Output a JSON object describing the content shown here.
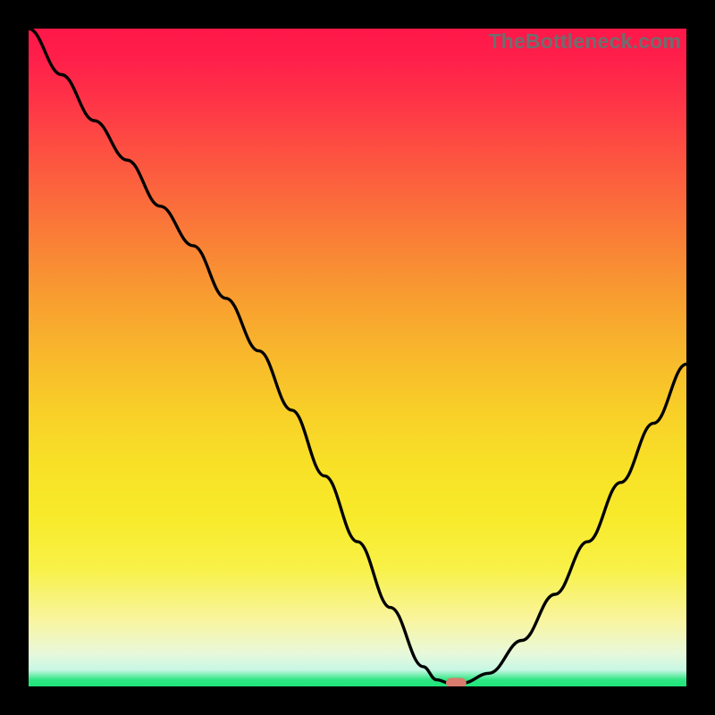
{
  "watermark": {
    "text": "TheBottleneck.com"
  },
  "colors": {
    "background": "#000000",
    "curve": "#000000",
    "marker": "#d77c6e"
  },
  "chart_data": {
    "type": "line",
    "title": "",
    "xlabel": "",
    "ylabel": "",
    "xlim": [
      0,
      100
    ],
    "ylim": [
      0,
      100
    ],
    "grid": false,
    "legend": null,
    "series": [
      {
        "name": "bottleneck-curve",
        "x": [
          0,
          5,
          10,
          15,
          20,
          25,
          30,
          35,
          40,
          45,
          50,
          55,
          60,
          62,
          64,
          66,
          70,
          75,
          80,
          85,
          90,
          95,
          100
        ],
        "values": [
          100,
          93,
          86,
          80,
          73,
          67,
          59,
          51,
          42,
          32,
          22,
          12,
          3,
          1,
          0.5,
          0.5,
          2,
          7,
          14,
          22,
          31,
          40,
          49
        ]
      }
    ],
    "marker": {
      "x": 65,
      "y": 0.5,
      "width_pct": 3.1,
      "height_pct": 1.6
    },
    "gradient_stops": [
      {
        "pct": 0,
        "hex": "#ff1749"
      },
      {
        "pct": 50,
        "hex": "#f8b92c"
      },
      {
        "pct": 82,
        "hex": "#f8f147"
      },
      {
        "pct": 99,
        "hex": "#2fe682"
      },
      {
        "pct": 100,
        "hex": "#1ee57b"
      }
    ]
  }
}
